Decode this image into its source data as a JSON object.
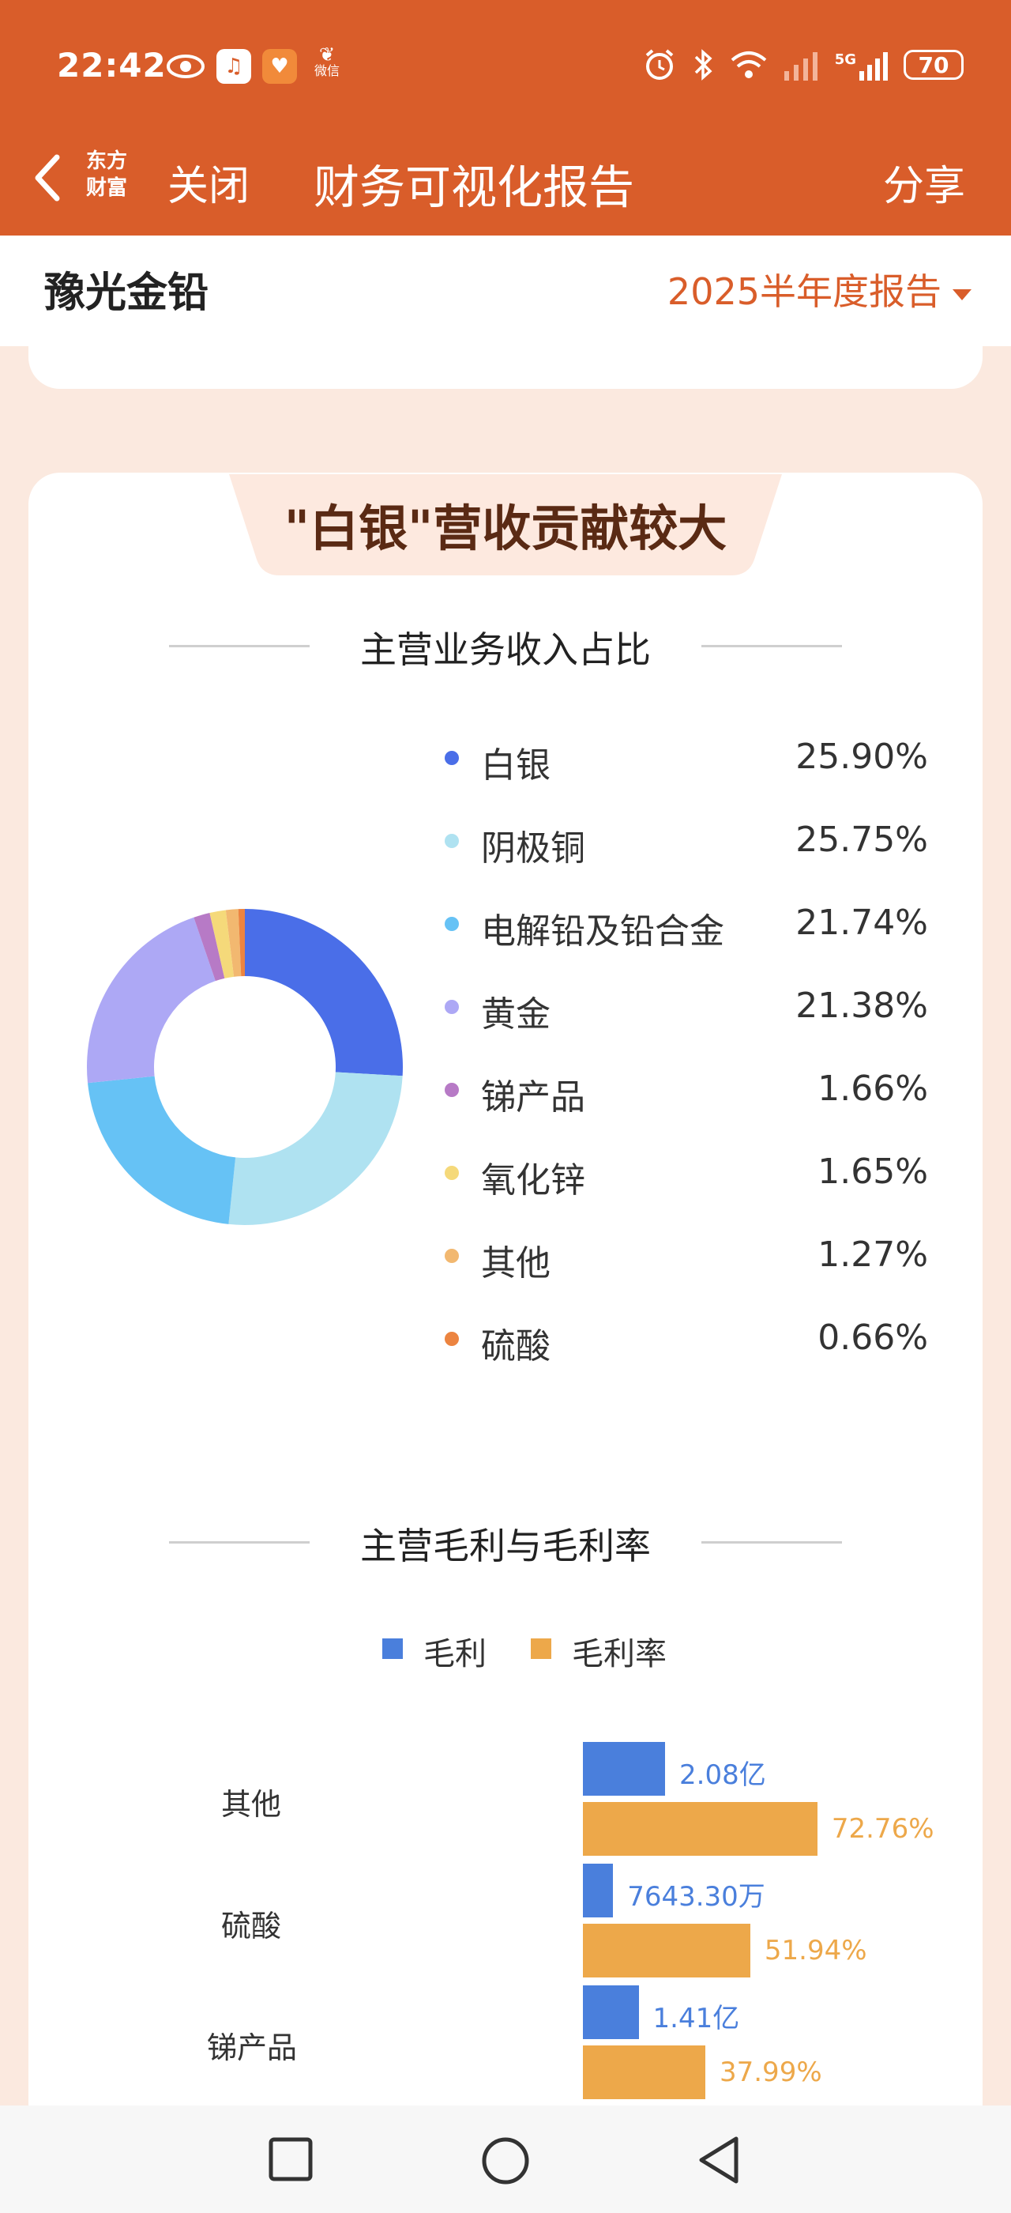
{
  "status": {
    "time": "22:42",
    "battery": "70",
    "network": "5G",
    "icons": [
      "eye-icon",
      "music-icon",
      "heart-app-icon",
      "app-icon",
      "alarm-icon",
      "bluetooth-icon",
      "wifi-icon",
      "signal-icon"
    ],
    "app_icon_text": "微信"
  },
  "header": {
    "logo": "东方\n财富",
    "close_label": "关闭",
    "title": "财务可视化报告",
    "share_label": "分享"
  },
  "company": {
    "name": "豫光金铅",
    "report_period": "2025半年度报告"
  },
  "banner": {
    "text": "\"白银\"营收贡献较大"
  },
  "revenue_section": {
    "title": "主营业务收入占比"
  },
  "profit_section": {
    "title": "主营毛利与毛利率",
    "legend": [
      "毛利",
      "毛利率"
    ]
  },
  "colors": {
    "brand": "#d95d2a",
    "profit_bar": "#4a7fdc",
    "margin_bar": "#eda84a"
  },
  "chart_data": [
    {
      "type": "pie",
      "title": "主营业务收入占比",
      "donut": true,
      "categories": [
        "白银",
        "阴极铜",
        "电解铅及铅合金",
        "黄金",
        "锑产品",
        "氧化锌",
        "其他",
        "硫酸"
      ],
      "values": [
        25.9,
        25.75,
        21.74,
        21.38,
        1.66,
        1.65,
        1.27,
        0.66
      ],
      "labels": [
        "25.90%",
        "25.75%",
        "21.74%",
        "21.38%",
        "1.66%",
        "1.65%",
        "1.27%",
        "0.66%"
      ],
      "colors": [
        "#4a6ee8",
        "#afe2f1",
        "#66c2f5",
        "#ada8f5",
        "#b77ac6",
        "#f5d97a",
        "#f2b870",
        "#ec8440"
      ]
    },
    {
      "type": "bar",
      "title": "主营毛利与毛利率",
      "categories": [
        "其他",
        "硫酸",
        "锑产品"
      ],
      "series": [
        {
          "name": "毛利",
          "values": [
            2.08,
            0.76433,
            1.41
          ],
          "labels": [
            "2.08亿",
            "7643.30万",
            "1.41亿"
          ]
        },
        {
          "name": "毛利率",
          "values": [
            72.76,
            51.94,
            37.99
          ],
          "labels": [
            "72.76%",
            "51.94%",
            "37.99%"
          ]
        }
      ]
    }
  ],
  "system_nav": {
    "icons": [
      "recents-square-icon",
      "home-circle-icon",
      "back-triangle-icon"
    ]
  }
}
